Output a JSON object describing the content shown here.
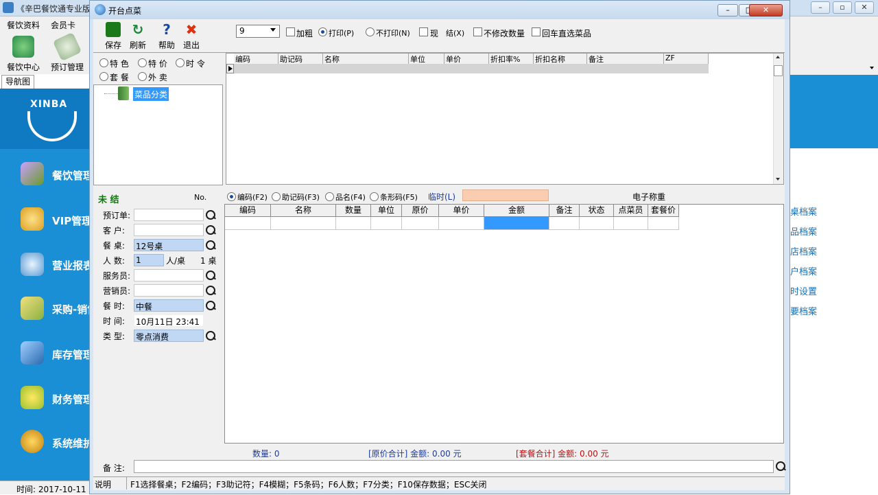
{
  "background_app": {
    "title": "《辛巴餐饮通专业版",
    "menus": [
      "餐饮资料",
      "会员卡"
    ],
    "tools": [
      {
        "label": "餐饮中心",
        "icon": "restaurant-center-icon"
      },
      {
        "label": "预订管理",
        "icon": "reservation-icon"
      }
    ],
    "nav_tab": "导航图",
    "logo": "XINBA",
    "nav_items": [
      {
        "label": "餐饮管理",
        "icon": "dining-icon"
      },
      {
        "label": "VIP管理",
        "icon": "vip-icon"
      },
      {
        "label": "营业报表",
        "icon": "report-icon"
      },
      {
        "label": "采购-销售",
        "icon": "truck-icon"
      },
      {
        "label": "库存管理",
        "icon": "inventory-icon"
      },
      {
        "label": "财务管理",
        "icon": "finance-icon"
      },
      {
        "label": "系统维护",
        "icon": "gear-icon"
      }
    ],
    "status": "时间: 2017-10-11",
    "right_links": [
      "桌档案",
      "品档案",
      "店档案",
      "户档案",
      "时设置",
      "要档案"
    ]
  },
  "dialog": {
    "title": "开台点菜",
    "toolbar": {
      "save": "保存",
      "refresh": "刷新",
      "help": "帮助",
      "exit": "退出"
    },
    "count_select": "9",
    "options": {
      "add_group": "加粗",
      "print": "打印(P)",
      "no_print": "不打印(N)",
      "cash": "现",
      "settle": "结(X)",
      "no_modify_qty": "不修改数量",
      "enter_select": "回车直选菜品"
    },
    "categories": {
      "special": "特 色",
      "promo": "特 价",
      "seasonal": "时 令",
      "set_meal": "套 餐",
      "takeout": "外 卖",
      "tree_root": "菜品分类"
    },
    "top_grid_headers": [
      "编码",
      "助记码",
      "名称",
      "单位",
      "单价",
      "折扣率%",
      "折扣名称",
      "备注",
      "ZF"
    ],
    "order": {
      "status": "未 结",
      "no_label": "No.",
      "fields": {
        "reservation": {
          "label": "预订单:",
          "value": ""
        },
        "customer": {
          "label": "客   户:",
          "value": ""
        },
        "table": {
          "label": "餐   桌:",
          "value": "12号桌"
        },
        "people_label": "人   数:",
        "people_value": "1",
        "people_unit": "人/桌",
        "table_count": "1 桌",
        "waiter": {
          "label": "服务员:",
          "value": ""
        },
        "sales": {
          "label": "营销员:",
          "value": ""
        },
        "meal": {
          "label": "餐   时:",
          "value": "中餐"
        },
        "time": {
          "label": "时   间:",
          "value": "10月11日 23:41"
        },
        "type": {
          "label": "类   型:",
          "value": "零点消费"
        }
      }
    },
    "search_modes": {
      "code": "编码(F2)",
      "mnemonic": "助记码(F3)",
      "name": "品名(F4)",
      "barcode": "条形码(F5)",
      "temp": "临时(L)",
      "scale": "电子称重"
    },
    "main_grid_headers": [
      "编码",
      "名称",
      "数量",
      "单位",
      "原价",
      "单价",
      "金额",
      "备注",
      "状态",
      "点菜员",
      "套餐价"
    ],
    "totals": {
      "quantity": "数量: 0",
      "original": "[原价合计] 金额:  0.00 元",
      "set_meal": "[套餐合计] 金额:  0.00 元"
    },
    "note_label": "备   注:",
    "statusbar": {
      "label": "说明",
      "text": "F1选择餐桌；F2编码；F3助记符；F4模糊；F5条码；F6人数；F7分类；F10保存数据；ESC关闭"
    }
  },
  "colors": {
    "nav_blue": "#1b8fd6",
    "status_green": "#0a7a0a",
    "total_blue": "#1a3aa0",
    "total_red": "#c01010",
    "search_input": "#fbcdb0",
    "selected": "#3399ff"
  }
}
